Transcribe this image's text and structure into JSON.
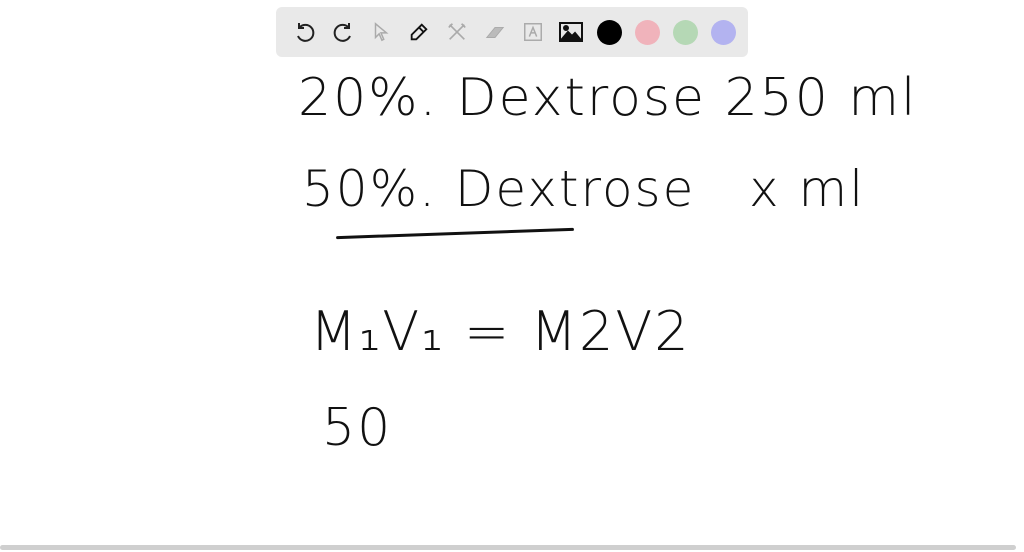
{
  "toolbar": {
    "tools": [
      "undo-icon",
      "redo-icon",
      "select-icon",
      "pen-icon",
      "tools-icon",
      "eraser-icon",
      "text-icon",
      "image-icon"
    ],
    "colors": [
      "#000000",
      "#f0b3bb",
      "#b5d8b5",
      "#b3b3f0"
    ]
  },
  "canvas": {
    "line1": "20%. Dextrose 250 ml",
    "line2": "50%. Dextrose   x ml",
    "line3": "M₁V₁ = M2V2",
    "line4": "50"
  }
}
